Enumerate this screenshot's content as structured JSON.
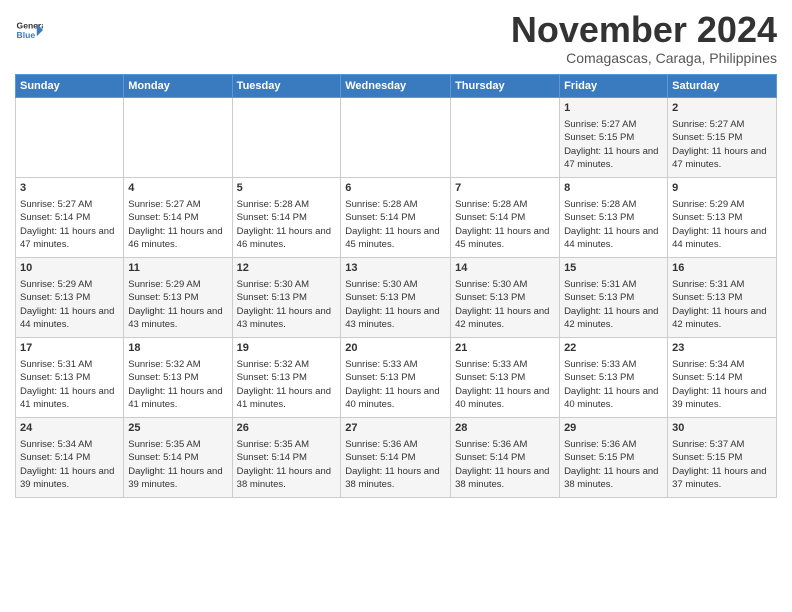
{
  "header": {
    "logo_line1": "General",
    "logo_line2": "Blue",
    "month": "November 2024",
    "location": "Comagascas, Caraga, Philippines"
  },
  "days_of_week": [
    "Sunday",
    "Monday",
    "Tuesday",
    "Wednesday",
    "Thursday",
    "Friday",
    "Saturday"
  ],
  "weeks": [
    [
      {
        "day": "",
        "info": ""
      },
      {
        "day": "",
        "info": ""
      },
      {
        "day": "",
        "info": ""
      },
      {
        "day": "",
        "info": ""
      },
      {
        "day": "",
        "info": ""
      },
      {
        "day": "1",
        "info": "Sunrise: 5:27 AM\nSunset: 5:15 PM\nDaylight: 11 hours and 47 minutes."
      },
      {
        "day": "2",
        "info": "Sunrise: 5:27 AM\nSunset: 5:15 PM\nDaylight: 11 hours and 47 minutes."
      }
    ],
    [
      {
        "day": "3",
        "info": "Sunrise: 5:27 AM\nSunset: 5:14 PM\nDaylight: 11 hours and 47 minutes."
      },
      {
        "day": "4",
        "info": "Sunrise: 5:27 AM\nSunset: 5:14 PM\nDaylight: 11 hours and 46 minutes."
      },
      {
        "day": "5",
        "info": "Sunrise: 5:28 AM\nSunset: 5:14 PM\nDaylight: 11 hours and 46 minutes."
      },
      {
        "day": "6",
        "info": "Sunrise: 5:28 AM\nSunset: 5:14 PM\nDaylight: 11 hours and 45 minutes."
      },
      {
        "day": "7",
        "info": "Sunrise: 5:28 AM\nSunset: 5:14 PM\nDaylight: 11 hours and 45 minutes."
      },
      {
        "day": "8",
        "info": "Sunrise: 5:28 AM\nSunset: 5:13 PM\nDaylight: 11 hours and 44 minutes."
      },
      {
        "day": "9",
        "info": "Sunrise: 5:29 AM\nSunset: 5:13 PM\nDaylight: 11 hours and 44 minutes."
      }
    ],
    [
      {
        "day": "10",
        "info": "Sunrise: 5:29 AM\nSunset: 5:13 PM\nDaylight: 11 hours and 44 minutes."
      },
      {
        "day": "11",
        "info": "Sunrise: 5:29 AM\nSunset: 5:13 PM\nDaylight: 11 hours and 43 minutes."
      },
      {
        "day": "12",
        "info": "Sunrise: 5:30 AM\nSunset: 5:13 PM\nDaylight: 11 hours and 43 minutes."
      },
      {
        "day": "13",
        "info": "Sunrise: 5:30 AM\nSunset: 5:13 PM\nDaylight: 11 hours and 43 minutes."
      },
      {
        "day": "14",
        "info": "Sunrise: 5:30 AM\nSunset: 5:13 PM\nDaylight: 11 hours and 42 minutes."
      },
      {
        "day": "15",
        "info": "Sunrise: 5:31 AM\nSunset: 5:13 PM\nDaylight: 11 hours and 42 minutes."
      },
      {
        "day": "16",
        "info": "Sunrise: 5:31 AM\nSunset: 5:13 PM\nDaylight: 11 hours and 42 minutes."
      }
    ],
    [
      {
        "day": "17",
        "info": "Sunrise: 5:31 AM\nSunset: 5:13 PM\nDaylight: 11 hours and 41 minutes."
      },
      {
        "day": "18",
        "info": "Sunrise: 5:32 AM\nSunset: 5:13 PM\nDaylight: 11 hours and 41 minutes."
      },
      {
        "day": "19",
        "info": "Sunrise: 5:32 AM\nSunset: 5:13 PM\nDaylight: 11 hours and 41 minutes."
      },
      {
        "day": "20",
        "info": "Sunrise: 5:33 AM\nSunset: 5:13 PM\nDaylight: 11 hours and 40 minutes."
      },
      {
        "day": "21",
        "info": "Sunrise: 5:33 AM\nSunset: 5:13 PM\nDaylight: 11 hours and 40 minutes."
      },
      {
        "day": "22",
        "info": "Sunrise: 5:33 AM\nSunset: 5:13 PM\nDaylight: 11 hours and 40 minutes."
      },
      {
        "day": "23",
        "info": "Sunrise: 5:34 AM\nSunset: 5:14 PM\nDaylight: 11 hours and 39 minutes."
      }
    ],
    [
      {
        "day": "24",
        "info": "Sunrise: 5:34 AM\nSunset: 5:14 PM\nDaylight: 11 hours and 39 minutes."
      },
      {
        "day": "25",
        "info": "Sunrise: 5:35 AM\nSunset: 5:14 PM\nDaylight: 11 hours and 39 minutes."
      },
      {
        "day": "26",
        "info": "Sunrise: 5:35 AM\nSunset: 5:14 PM\nDaylight: 11 hours and 38 minutes."
      },
      {
        "day": "27",
        "info": "Sunrise: 5:36 AM\nSunset: 5:14 PM\nDaylight: 11 hours and 38 minutes."
      },
      {
        "day": "28",
        "info": "Sunrise: 5:36 AM\nSunset: 5:14 PM\nDaylight: 11 hours and 38 minutes."
      },
      {
        "day": "29",
        "info": "Sunrise: 5:36 AM\nSunset: 5:15 PM\nDaylight: 11 hours and 38 minutes."
      },
      {
        "day": "30",
        "info": "Sunrise: 5:37 AM\nSunset: 5:15 PM\nDaylight: 11 hours and 37 minutes."
      }
    ]
  ]
}
